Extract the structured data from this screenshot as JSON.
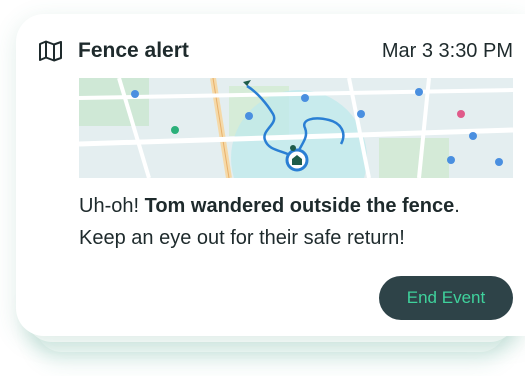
{
  "alert": {
    "title": "Fence alert",
    "timestamp": "Mar 3 3:30 PM",
    "icon": "map-icon",
    "message_prefix": "Uh-oh! ",
    "message_bold": "Tom wandered outside the fence",
    "message_suffix": ".",
    "message_line2": "Keep an eye out for their safe return!",
    "end_button_label": "End Event"
  },
  "colors": {
    "title_text": "#1e2a2c",
    "button_bg": "#2e4348",
    "button_text": "#3fd29c",
    "route": "#2a7fd4",
    "fence_fill": "#bfe9ec"
  }
}
